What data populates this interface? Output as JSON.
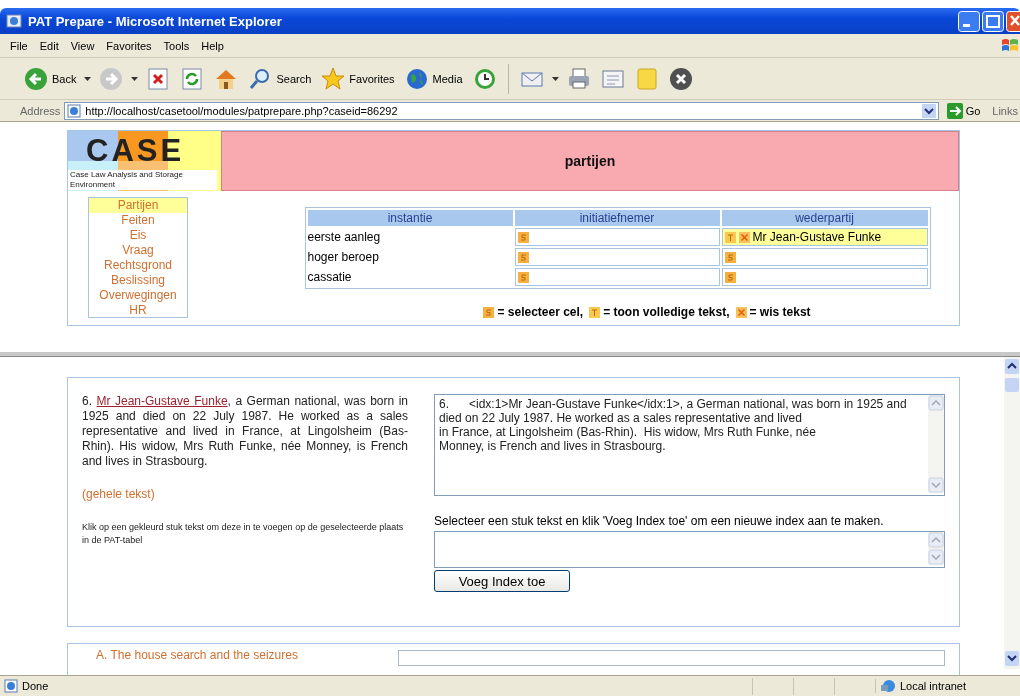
{
  "window": {
    "title": "PAT Prepare - Microsoft Internet Explorer"
  },
  "menu": [
    "File",
    "Edit",
    "View",
    "Favorites",
    "Tools",
    "Help"
  ],
  "toolbar": [
    {
      "kind": "back",
      "label": "Back"
    },
    {
      "kind": "forward"
    },
    {
      "kind": "stop"
    },
    {
      "kind": "refresh"
    },
    {
      "kind": "home"
    },
    {
      "kind": "search",
      "label": "Search"
    },
    {
      "kind": "favorites",
      "label": "Favorites"
    },
    {
      "kind": "media",
      "label": "Media"
    },
    {
      "kind": "history"
    },
    {
      "kind": "mail"
    },
    {
      "kind": "print"
    },
    {
      "kind": "edit"
    },
    {
      "kind": "note"
    },
    {
      "kind": "close"
    }
  ],
  "address": {
    "label": "Address",
    "value": "http://localhost/casetool/modules/patprepare.php?caseid=86292",
    "go": "Go",
    "links": "Links"
  },
  "header": {
    "logo": "CASE",
    "logo_subtitle": "Case Law Analysis and Storage Environment",
    "title": "partijen"
  },
  "nav": [
    {
      "label": "Partijen",
      "selected": true
    },
    {
      "label": "Feiten",
      "selected": false
    },
    {
      "label": "Eis",
      "selected": false
    },
    {
      "label": "Vraag",
      "selected": false
    },
    {
      "label": "Rechtsgrond",
      "selected": false
    },
    {
      "label": "Beslissing",
      "selected": false
    },
    {
      "label": "Overwegingen",
      "selected": false
    },
    {
      "label": "HR",
      "selected": false
    }
  ],
  "table": {
    "columns": [
      "instantie",
      "initiatiefnemer",
      "wederpartij"
    ],
    "rows": [
      {
        "cells": [
          {
            "kind": "label",
            "value": "eerste aanleg"
          },
          {
            "kind": "slot",
            "filled": false
          },
          {
            "kind": "slot",
            "filled": true,
            "value": "Mr Jean-Gustave Funke"
          }
        ]
      },
      {
        "cells": [
          {
            "kind": "label",
            "value": "hoger beroep"
          },
          {
            "kind": "slot",
            "filled": false
          },
          {
            "kind": "slot",
            "filled": false
          }
        ]
      },
      {
        "cells": [
          {
            "kind": "label",
            "value": "cassatie"
          },
          {
            "kind": "slot",
            "filled": false
          },
          {
            "kind": "slot",
            "filled": false
          }
        ]
      }
    ]
  },
  "legend": [
    {
      "kind": "select",
      "text": "= selecteer cel,"
    },
    {
      "kind": "show",
      "text": "= toon volledige tekst,"
    },
    {
      "kind": "clear",
      "text": "= wis tekst"
    }
  ],
  "paragraph": {
    "number": "6.",
    "link": "Mr Jean-Gustave Funke",
    "text": ", a German national, was born in 1925 and died on 22 July 1987. He worked as a sales representative and lived in France, at Lingolsheim (Bas-Rhin). His widow, Mrs Ruth Funke, née Monney, is French and lives in Strasbourg."
  },
  "full_text_link": "(gehele tekst)",
  "hint": "Klik op een gekleurd stuk tekst om deze in te voegen op de geselecteerde plaats in de PAT-tabel",
  "source_text": "6.      <idx:1>Mr Jean-Gustave Funke</idx:1>, a German national, was born in 1925 and\ndied on 22 July 1987. He worked as a sales representative and lived\nin France, at Lingolsheim (Bas-Rhin).  His widow, Mrs Ruth Funke, née\nMonney, is French and lives in Strasbourg.",
  "index_label": "Selecteer een stuk tekst en klik 'Voeg Index toe' om een nieuwe index aan te maken.",
  "index_button": "Voeg Index toe",
  "next_section": {
    "title": "A. The house search and the seizures"
  },
  "status_bar": {
    "text": "Done",
    "zone": "Local intranet"
  }
}
